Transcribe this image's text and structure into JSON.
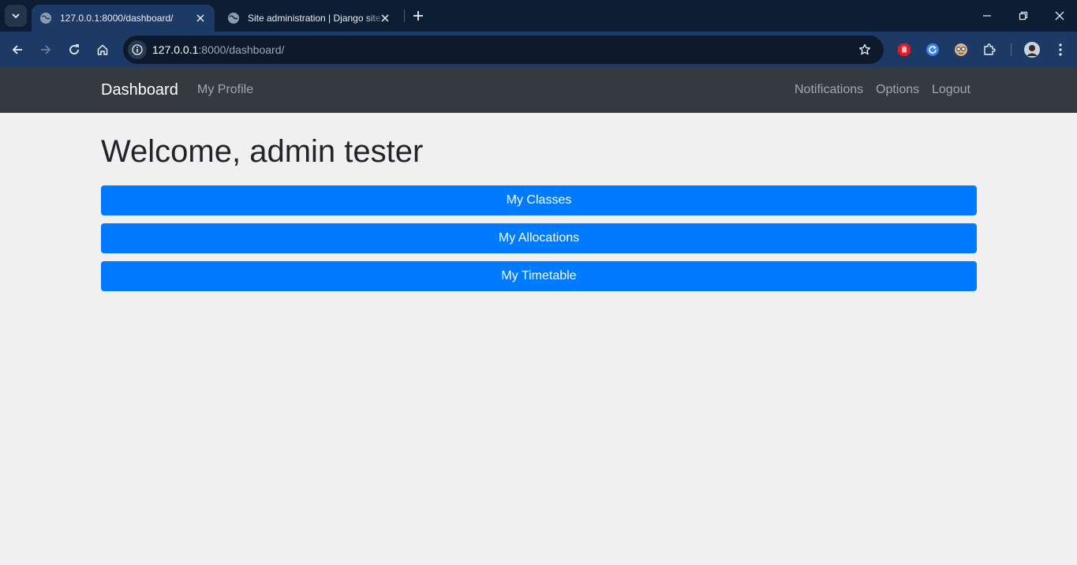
{
  "browser": {
    "tabs": [
      {
        "title": "127.0.0.1:8000/dashboard/",
        "active": true
      },
      {
        "title": "Site administration | Django site admin",
        "active": false
      }
    ],
    "url": {
      "host": "127.0.0.1",
      "path": ":8000/dashboard/"
    },
    "icons": [
      "tab-search-icon",
      "globe-icon",
      "close-icon",
      "new-tab-icon",
      "minimize-icon",
      "restore-icon",
      "close-window-icon",
      "back-icon",
      "forward-icon",
      "reload-icon",
      "home-icon",
      "info-icon",
      "bookmark-star-icon",
      "extension-stop-icon",
      "extension-refresh-icon",
      "extension-face-icon",
      "extensions-puzzle-icon",
      "profile-avatar",
      "menu-kebab-icon"
    ]
  },
  "navbar": {
    "brand": "Dashboard",
    "left_links": [
      "My Profile"
    ],
    "right_links": [
      "Notifications",
      "Options",
      "Logout"
    ],
    "background": "#343a40"
  },
  "main": {
    "welcome": "Welcome, admin tester",
    "buttons": [
      "My Classes",
      "My Allocations",
      "My Timetable"
    ],
    "button_color": "#007bff"
  }
}
